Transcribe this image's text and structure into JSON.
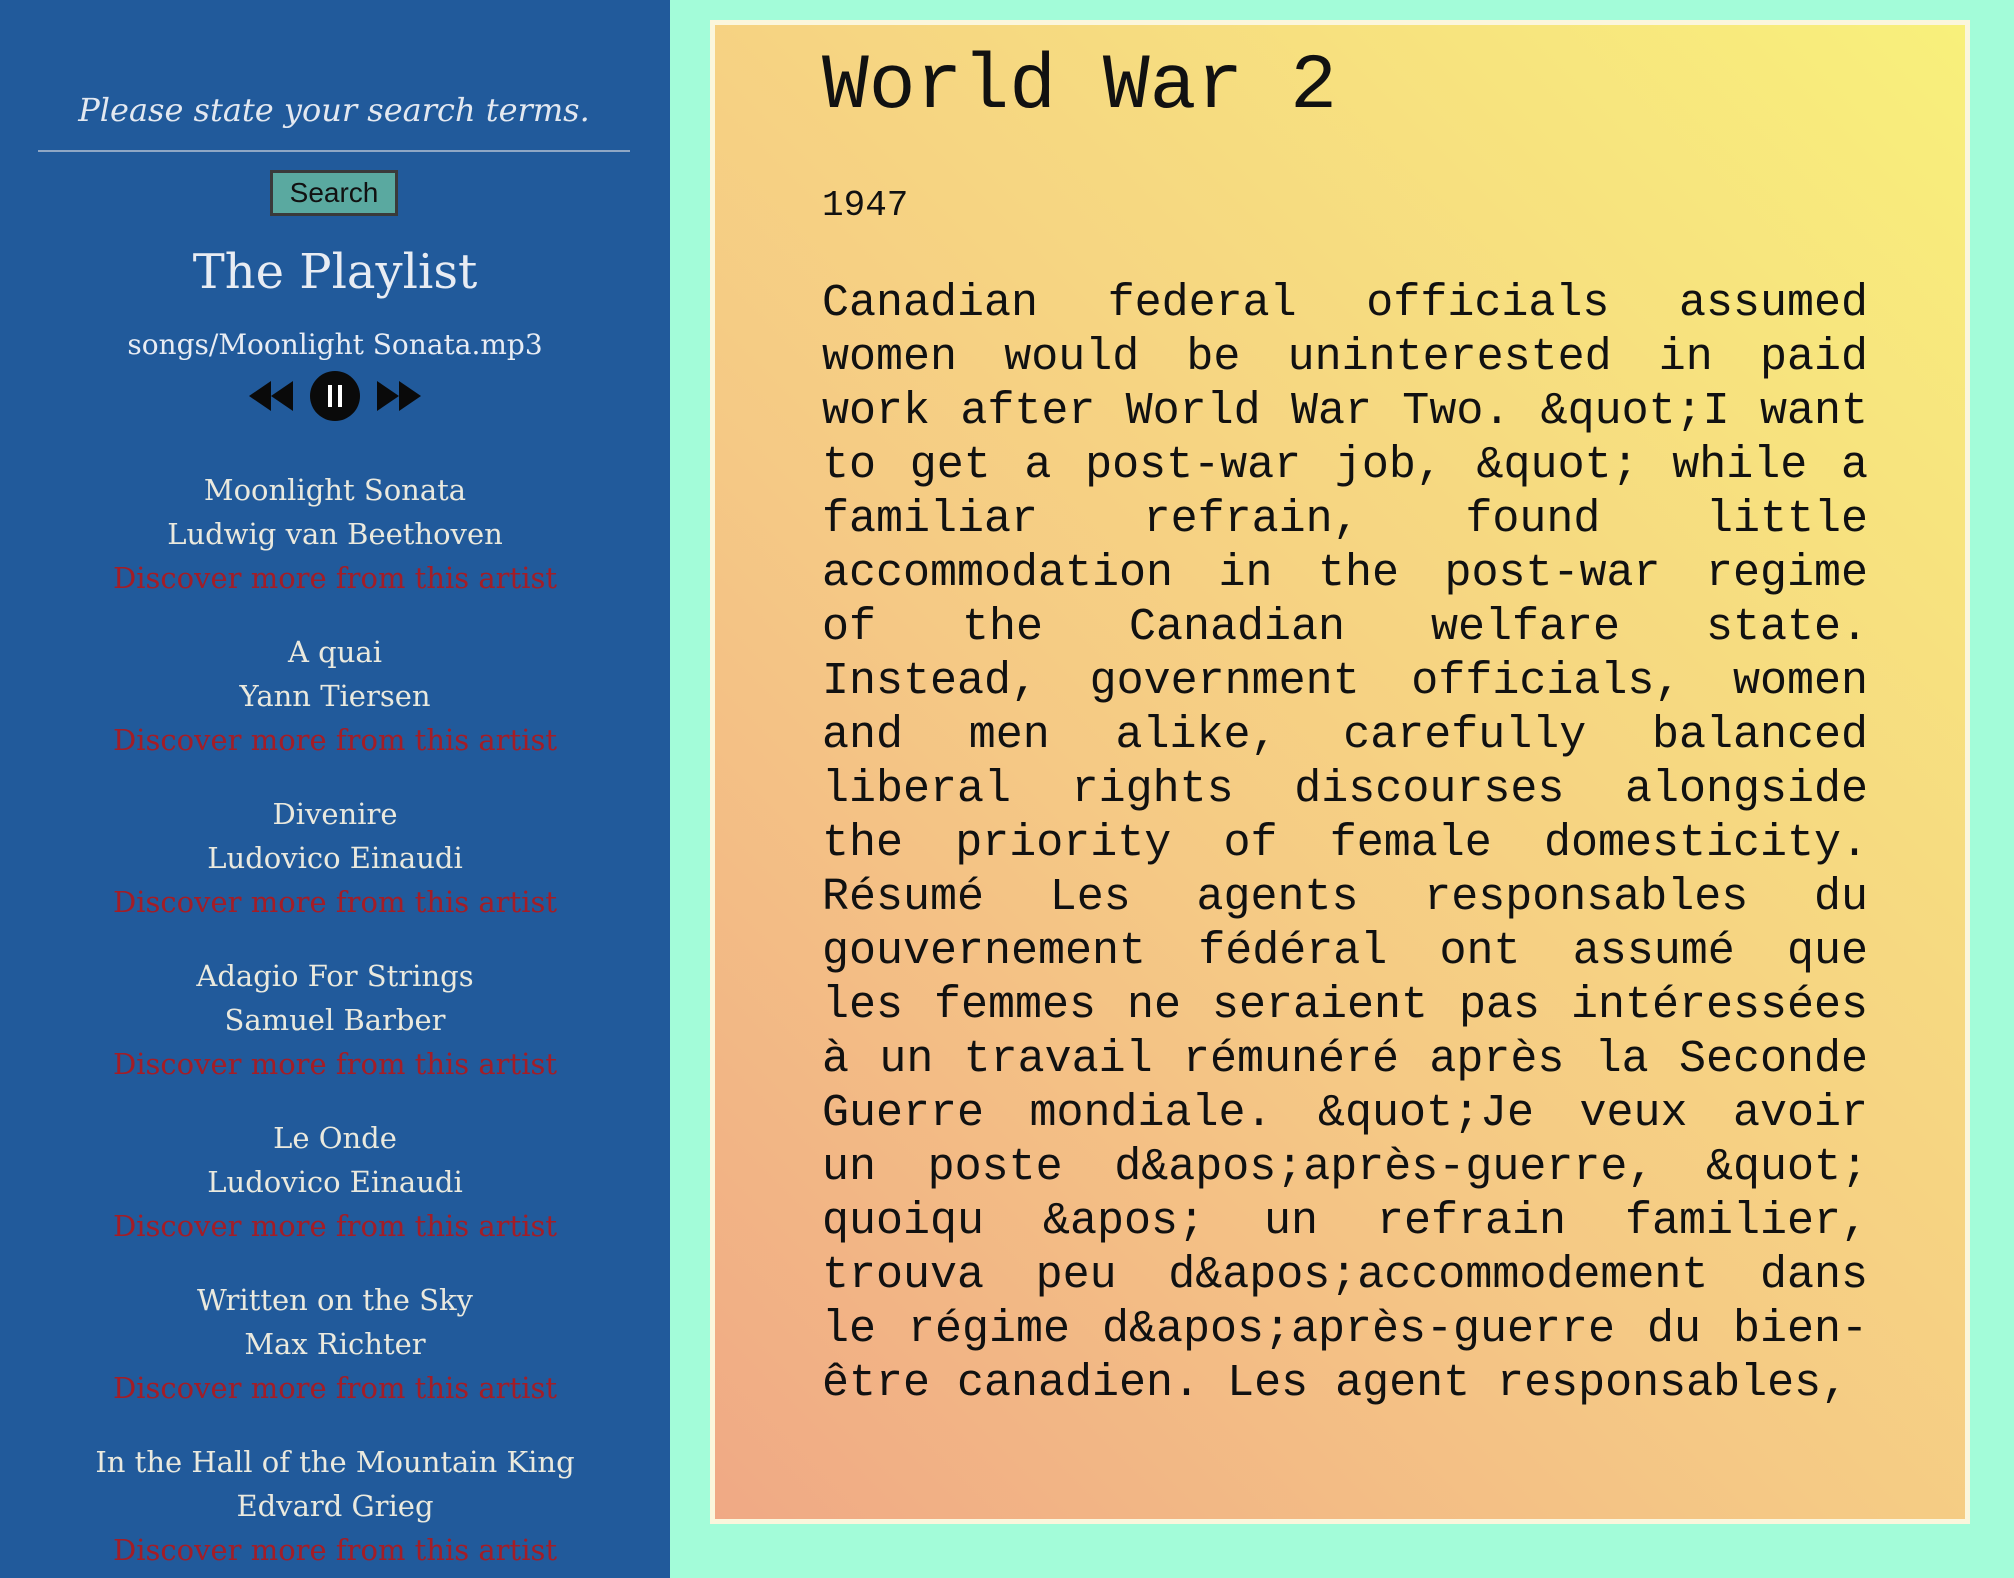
{
  "search": {
    "placeholder": "Please state your search terms.",
    "button_label": "Search"
  },
  "playlist": {
    "title": "The Playlist",
    "now_playing": "songs/Moonlight Sonata.mp3",
    "controls": {
      "previous_icon": "rewind-icon",
      "play_pause_icon": "pause-icon",
      "next_icon": "fast-forward-icon"
    },
    "songs": [
      {
        "title": "Moonlight Sonata",
        "artist": "Ludwig van Beethoven",
        "link": "Discover more from this artist"
      },
      {
        "title": "A quai",
        "artist": "Yann Tiersen",
        "link": "Discover more from this artist"
      },
      {
        "title": "Divenire",
        "artist": "Ludovico Einaudi",
        "link": "Discover more from this artist"
      },
      {
        "title": "Adagio For Strings",
        "artist": "Samuel Barber",
        "link": "Discover more from this artist"
      },
      {
        "title": "Le Onde",
        "artist": "Ludovico Einaudi",
        "link": "Discover more from this artist"
      },
      {
        "title": "Written on the Sky",
        "artist": "Max Richter",
        "link": "Discover more from this artist"
      },
      {
        "title": "In the Hall of the Mountain King",
        "artist": "Edvard Grieg",
        "link": "Discover more from this artist"
      }
    ]
  },
  "article": {
    "title": "World War 2",
    "year": "1947",
    "body": "Canadian federal officials assumed women would be uninterested in paid work after World War Two. &quot;I want to get a post-war job, &quot; while a familiar refrain, found little accommodation in the post-war regime of the Canadian welfare state. Instead, government officials, women and men alike, carefully balanced liberal rights discourses alongside the priority of female domesticity. Résumé Les agents responsables du gouvernement fédéral ont assumé que les femmes ne seraient pas intéressées à un travail rémunéré après la Seconde Guerre mondiale. &quot;Je veux avoir un poste d&apos;après-guerre, &quot; quoiqu &apos; un refrain familier, trouva peu d&apos;accommodement dans le régime d&apos;après-guerre du bien-être canadien. Les agent responsables,"
  },
  "colors": {
    "sidebar_bg": "#215a9b",
    "page_bg": "#a3fcd9",
    "link": "#a41d26",
    "button": "#5aa9a0"
  }
}
